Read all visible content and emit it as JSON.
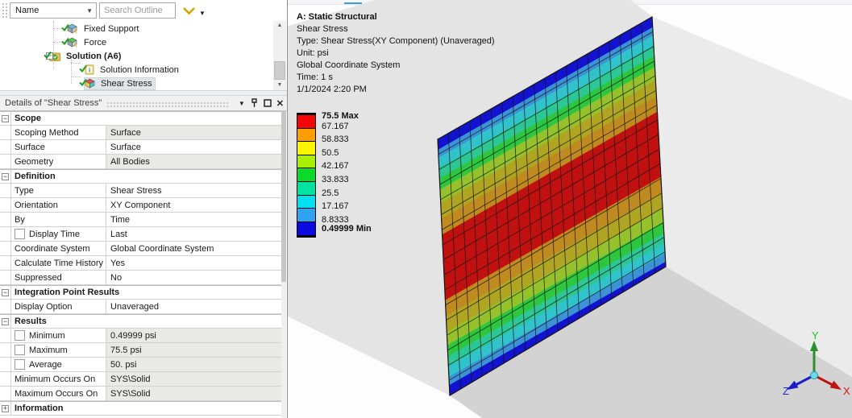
{
  "outline_toolbar": {
    "name_filter": "Name",
    "search_placeholder": "Search Outline"
  },
  "tree": {
    "items": [
      {
        "label": "Fixed Support",
        "icon": "fixed-support-icon",
        "level": 1,
        "checked": true
      },
      {
        "label": "Force",
        "icon": "force-icon",
        "level": 1,
        "checked": true
      },
      {
        "label": "Solution (A6)",
        "icon": "solution-icon",
        "level": 0,
        "bold": true,
        "expander": "minus",
        "checked": true
      },
      {
        "label": "Solution Information",
        "icon": "solution-information-icon",
        "level": 2,
        "checked": true
      },
      {
        "label": "Shear Stress",
        "icon": "result-icon",
        "level": 2,
        "selected": true,
        "checked": true
      }
    ]
  },
  "details": {
    "title": "Details of \"Shear Stress\"",
    "rows": [
      {
        "kind": "category",
        "label": "Scope",
        "expander": "minus"
      },
      {
        "kind": "prop",
        "label": "Scoping Method",
        "value": "Surface",
        "readonly": true
      },
      {
        "kind": "prop",
        "label": "Surface",
        "value": "Surface"
      },
      {
        "kind": "prop",
        "label": "Geometry",
        "value": "All Bodies",
        "readonly": true
      },
      {
        "kind": "category",
        "label": "Definition",
        "expander": "minus"
      },
      {
        "kind": "prop",
        "label": "Type",
        "value": "Shear Stress"
      },
      {
        "kind": "prop",
        "label": "Orientation",
        "value": "XY Component"
      },
      {
        "kind": "prop",
        "label": "By",
        "value": "Time"
      },
      {
        "kind": "prop",
        "label": "Display Time",
        "value": "Last",
        "checkbox": true
      },
      {
        "kind": "prop",
        "label": "Coordinate System",
        "value": "Global Coordinate System"
      },
      {
        "kind": "prop",
        "label": "Calculate Time History",
        "value": "Yes"
      },
      {
        "kind": "prop",
        "label": "Suppressed",
        "value": "No"
      },
      {
        "kind": "category",
        "label": "Integration Point Results",
        "expander": "minus"
      },
      {
        "kind": "prop",
        "label": "Display Option",
        "value": "Unaveraged"
      },
      {
        "kind": "category",
        "label": "Results",
        "expander": "minus"
      },
      {
        "kind": "prop",
        "label": "Minimum",
        "value": "0.49999 psi",
        "checkbox": true,
        "readonly": true
      },
      {
        "kind": "prop",
        "label": "Maximum",
        "value": "75.5 psi",
        "checkbox": true,
        "readonly": true
      },
      {
        "kind": "prop",
        "label": "Average",
        "value": "50. psi",
        "checkbox": true,
        "readonly": true
      },
      {
        "kind": "prop",
        "label": "Minimum Occurs On",
        "value": "SYS\\Solid",
        "readonly": true
      },
      {
        "kind": "prop",
        "label": "Maximum Occurs On",
        "value": "SYS\\Solid",
        "readonly": true
      },
      {
        "kind": "category",
        "label": "Information",
        "expander": "plus"
      }
    ],
    "header_icons": {
      "dropdown": "▼",
      "close": "✕"
    }
  },
  "viewport": {
    "annotation": [
      "A: Static Structural",
      "Shear Stress",
      "Type: Shear Stress(XY Component) (Unaveraged)",
      "Unit: psi",
      "Global Coordinate System",
      "Time: 1 s",
      "1/1/2024 2:20 PM"
    ],
    "legend": {
      "labels": [
        "75.5 Max",
        "67.167",
        "58.833",
        "50.5",
        "42.167",
        "33.833",
        "25.5",
        "17.167",
        "8.8333",
        "0.49999 Min"
      ],
      "colors": [
        "#f40606",
        "#ff9e01",
        "#fcf501",
        "#a9ef00",
        "#0bdb28",
        "#00e2a2",
        "#01dff0",
        "#2fa2f1",
        "#0a0ae1"
      ]
    },
    "plate": {
      "palette": {
        "red": "#c11010",
        "tan": "#bf8a20",
        "olive": "#b0a522",
        "ygreen": "#95c22c",
        "green": "#2dc63e",
        "mint": "#2dc795",
        "cyan": "#30c3cb",
        "sky": "#3b93d6",
        "blue": "#1313cf"
      },
      "segments": [
        {
          "color": "blue",
          "from": 0.0,
          "to": 0.04
        },
        {
          "color": "sky",
          "from": 0.04,
          "to": 0.072
        },
        {
          "color": "cyan",
          "from": 0.072,
          "to": 0.112
        },
        {
          "color": "mint",
          "from": 0.112,
          "to": 0.152
        },
        {
          "color": "green",
          "from": 0.152,
          "to": 0.196
        },
        {
          "color": "ygreen",
          "from": 0.196,
          "to": 0.248
        },
        {
          "color": "olive",
          "from": 0.248,
          "to": 0.31
        },
        {
          "color": "tan",
          "from": 0.31,
          "to": 0.372
        },
        {
          "color": "red",
          "from": 0.372,
          "to": 0.628
        },
        {
          "color": "tan",
          "from": 0.628,
          "to": 0.69
        },
        {
          "color": "olive",
          "from": 0.69,
          "to": 0.752
        },
        {
          "color": "ygreen",
          "from": 0.752,
          "to": 0.804
        },
        {
          "color": "green",
          "from": 0.804,
          "to": 0.848
        },
        {
          "color": "mint",
          "from": 0.848,
          "to": 0.888
        },
        {
          "color": "cyan",
          "from": 0.888,
          "to": 0.928
        },
        {
          "color": "sky",
          "from": 0.928,
          "to": 0.96
        },
        {
          "color": "blue",
          "from": 0.96,
          "to": 1.0
        }
      ]
    },
    "triad": {
      "x": {
        "label": "X",
        "color": "#e01212"
      },
      "y": {
        "label": "Y",
        "color": "#12c212"
      },
      "z": {
        "label": "Z",
        "color": "#2222e0"
      }
    },
    "block_colors": {
      "left_face": "#e4e4e4",
      "right_face": "#ebebeb",
      "floor": "#d3d3d3"
    },
    "accent_blue": "#3f9ddb"
  }
}
